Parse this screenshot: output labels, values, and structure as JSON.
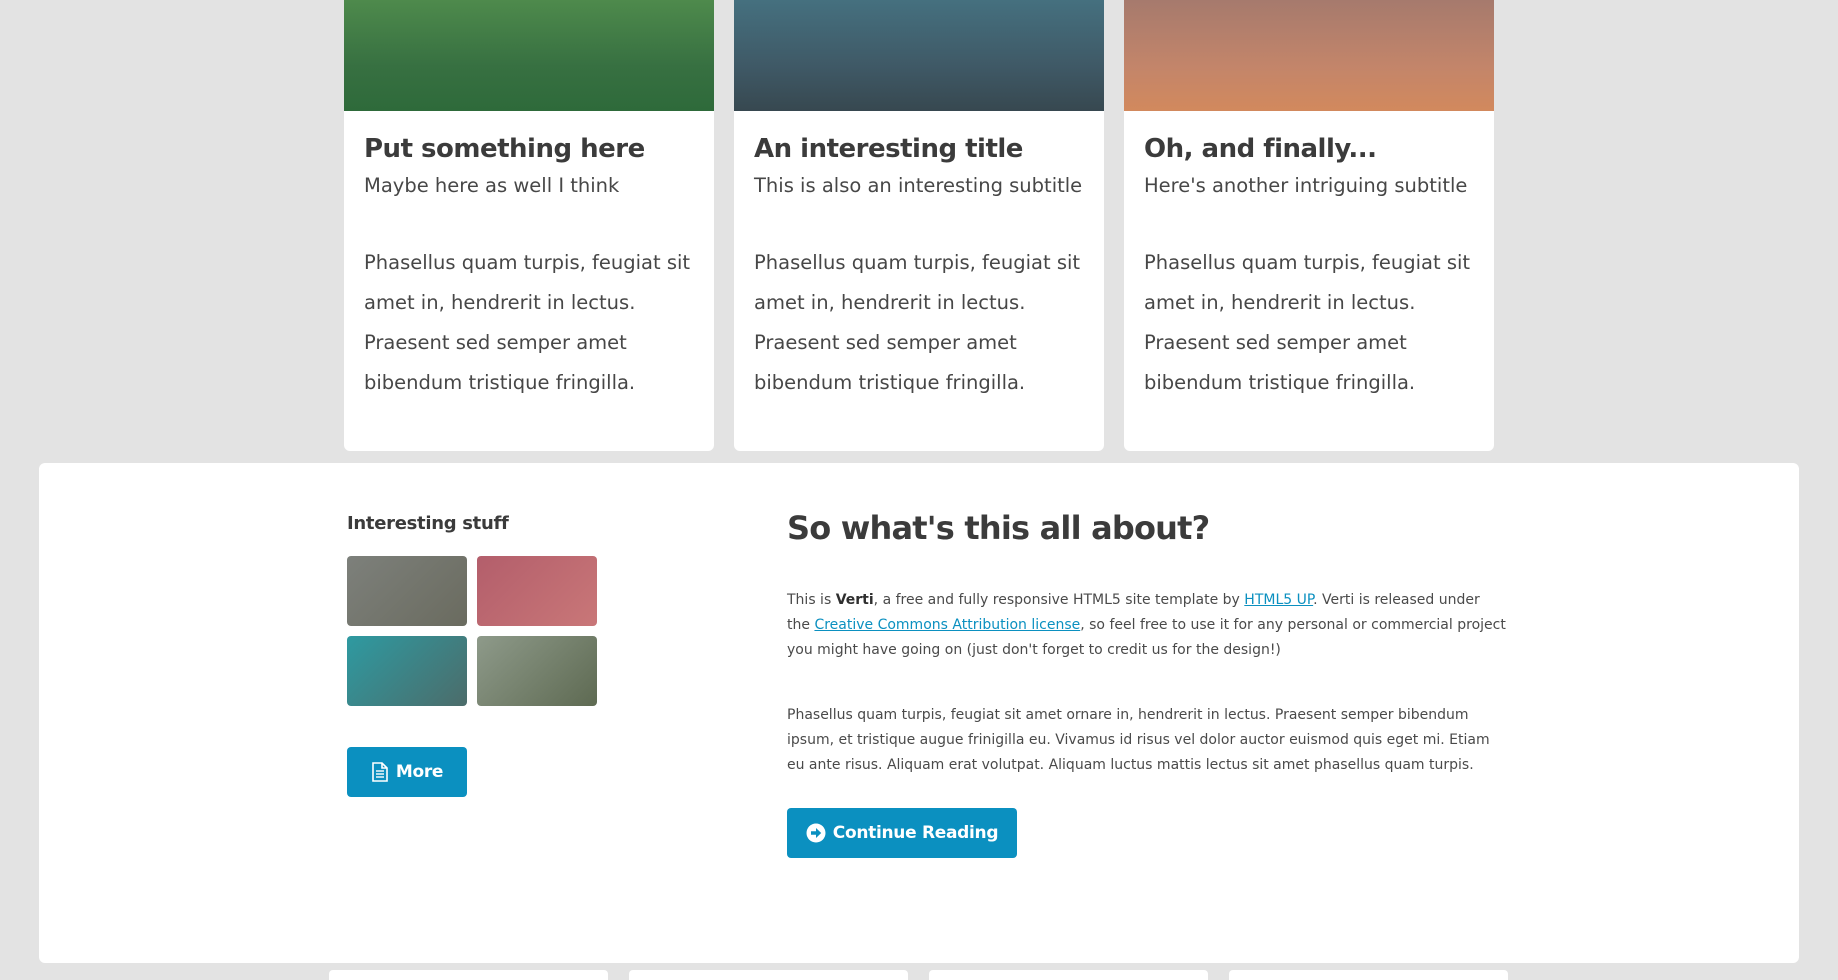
{
  "features": [
    {
      "title": "Put something here",
      "subtitle": "Maybe here as well I think",
      "text": "Phasellus quam turpis, feugiat sit amet in, hendrerit in lectus. Praesent sed semper amet bibendum tristique fringilla."
    },
    {
      "title": "An interesting title",
      "subtitle": "This is also an interesting subtitle",
      "text": "Phasellus quam turpis, feugiat sit amet in, hendrerit in lectus. Praesent sed semper amet bibendum tristique fringilla."
    },
    {
      "title": "Oh, and finally...",
      "subtitle": "Here's another intriguing subtitle",
      "text": "Phasellus quam turpis, feugiat sit amet in, hendrerit in lectus. Praesent sed semper amet bibendum tristique fringilla."
    }
  ],
  "sidebar": {
    "title": "Interesting stuff",
    "more_label": "More",
    "more_icon": "document-icon"
  },
  "main": {
    "title": "So what's this all about?",
    "para1": {
      "t1": "This is ",
      "brand": "Verti",
      "t2": ", a free and fully responsive HTML5 site template by ",
      "link1": "HTML5 UP",
      "t3": ". Verti is released under the ",
      "link2": "Creative Commons Attribution license",
      "t4": ", so feel free to use it for any personal or commercial project you might have going on (just don't forget to credit us for the design!)"
    },
    "para2": "Phasellus quam turpis, feugiat sit amet ornare in, hendrerit in lectus. Praesent semper bibendum ipsum, et tristique augue frinigilla eu. Vivamus id risus vel dolor auctor euismod quis eget mi. Etiam eu ante risus. Aliquam erat volutpat. Aliquam luctus mattis lectus sit amet phasellus quam turpis.",
    "continue_label": "Continue Reading",
    "continue_icon": "arrow-circle-right-icon"
  },
  "colors": {
    "accent": "#0b90c0",
    "background": "#e3e3e3",
    "text": "#474747"
  }
}
